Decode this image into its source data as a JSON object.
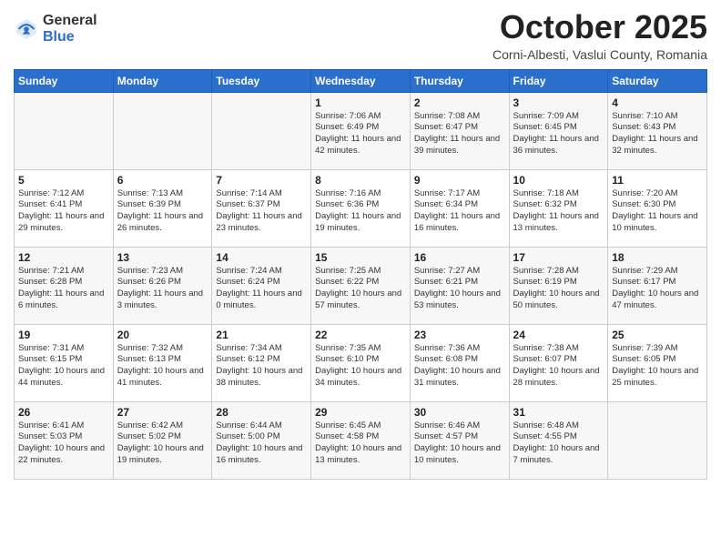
{
  "header": {
    "logo_general": "General",
    "logo_blue": "Blue",
    "month": "October 2025",
    "location": "Corni-Albesti, Vaslui County, Romania"
  },
  "weekdays": [
    "Sunday",
    "Monday",
    "Tuesday",
    "Wednesday",
    "Thursday",
    "Friday",
    "Saturday"
  ],
  "weeks": [
    [
      {
        "day": "",
        "info": ""
      },
      {
        "day": "",
        "info": ""
      },
      {
        "day": "",
        "info": ""
      },
      {
        "day": "1",
        "info": "Sunrise: 7:06 AM\nSunset: 6:49 PM\nDaylight: 11 hours and 42 minutes."
      },
      {
        "day": "2",
        "info": "Sunrise: 7:08 AM\nSunset: 6:47 PM\nDaylight: 11 hours and 39 minutes."
      },
      {
        "day": "3",
        "info": "Sunrise: 7:09 AM\nSunset: 6:45 PM\nDaylight: 11 hours and 36 minutes."
      },
      {
        "day": "4",
        "info": "Sunrise: 7:10 AM\nSunset: 6:43 PM\nDaylight: 11 hours and 32 minutes."
      }
    ],
    [
      {
        "day": "5",
        "info": "Sunrise: 7:12 AM\nSunset: 6:41 PM\nDaylight: 11 hours and 29 minutes."
      },
      {
        "day": "6",
        "info": "Sunrise: 7:13 AM\nSunset: 6:39 PM\nDaylight: 11 hours and 26 minutes."
      },
      {
        "day": "7",
        "info": "Sunrise: 7:14 AM\nSunset: 6:37 PM\nDaylight: 11 hours and 23 minutes."
      },
      {
        "day": "8",
        "info": "Sunrise: 7:16 AM\nSunset: 6:36 PM\nDaylight: 11 hours and 19 minutes."
      },
      {
        "day": "9",
        "info": "Sunrise: 7:17 AM\nSunset: 6:34 PM\nDaylight: 11 hours and 16 minutes."
      },
      {
        "day": "10",
        "info": "Sunrise: 7:18 AM\nSunset: 6:32 PM\nDaylight: 11 hours and 13 minutes."
      },
      {
        "day": "11",
        "info": "Sunrise: 7:20 AM\nSunset: 6:30 PM\nDaylight: 11 hours and 10 minutes."
      }
    ],
    [
      {
        "day": "12",
        "info": "Sunrise: 7:21 AM\nSunset: 6:28 PM\nDaylight: 11 hours and 6 minutes."
      },
      {
        "day": "13",
        "info": "Sunrise: 7:23 AM\nSunset: 6:26 PM\nDaylight: 11 hours and 3 minutes."
      },
      {
        "day": "14",
        "info": "Sunrise: 7:24 AM\nSunset: 6:24 PM\nDaylight: 11 hours and 0 minutes."
      },
      {
        "day": "15",
        "info": "Sunrise: 7:25 AM\nSunset: 6:22 PM\nDaylight: 10 hours and 57 minutes."
      },
      {
        "day": "16",
        "info": "Sunrise: 7:27 AM\nSunset: 6:21 PM\nDaylight: 10 hours and 53 minutes."
      },
      {
        "day": "17",
        "info": "Sunrise: 7:28 AM\nSunset: 6:19 PM\nDaylight: 10 hours and 50 minutes."
      },
      {
        "day": "18",
        "info": "Sunrise: 7:29 AM\nSunset: 6:17 PM\nDaylight: 10 hours and 47 minutes."
      }
    ],
    [
      {
        "day": "19",
        "info": "Sunrise: 7:31 AM\nSunset: 6:15 PM\nDaylight: 10 hours and 44 minutes."
      },
      {
        "day": "20",
        "info": "Sunrise: 7:32 AM\nSunset: 6:13 PM\nDaylight: 10 hours and 41 minutes."
      },
      {
        "day": "21",
        "info": "Sunrise: 7:34 AM\nSunset: 6:12 PM\nDaylight: 10 hours and 38 minutes."
      },
      {
        "day": "22",
        "info": "Sunrise: 7:35 AM\nSunset: 6:10 PM\nDaylight: 10 hours and 34 minutes."
      },
      {
        "day": "23",
        "info": "Sunrise: 7:36 AM\nSunset: 6:08 PM\nDaylight: 10 hours and 31 minutes."
      },
      {
        "day": "24",
        "info": "Sunrise: 7:38 AM\nSunset: 6:07 PM\nDaylight: 10 hours and 28 minutes."
      },
      {
        "day": "25",
        "info": "Sunrise: 7:39 AM\nSunset: 6:05 PM\nDaylight: 10 hours and 25 minutes."
      }
    ],
    [
      {
        "day": "26",
        "info": "Sunrise: 6:41 AM\nSunset: 5:03 PM\nDaylight: 10 hours and 22 minutes."
      },
      {
        "day": "27",
        "info": "Sunrise: 6:42 AM\nSunset: 5:02 PM\nDaylight: 10 hours and 19 minutes."
      },
      {
        "day": "28",
        "info": "Sunrise: 6:44 AM\nSunset: 5:00 PM\nDaylight: 10 hours and 16 minutes."
      },
      {
        "day": "29",
        "info": "Sunrise: 6:45 AM\nSunset: 4:58 PM\nDaylight: 10 hours and 13 minutes."
      },
      {
        "day": "30",
        "info": "Sunrise: 6:46 AM\nSunset: 4:57 PM\nDaylight: 10 hours and 10 minutes."
      },
      {
        "day": "31",
        "info": "Sunrise: 6:48 AM\nSunset: 4:55 PM\nDaylight: 10 hours and 7 minutes."
      },
      {
        "day": "",
        "info": ""
      }
    ]
  ]
}
